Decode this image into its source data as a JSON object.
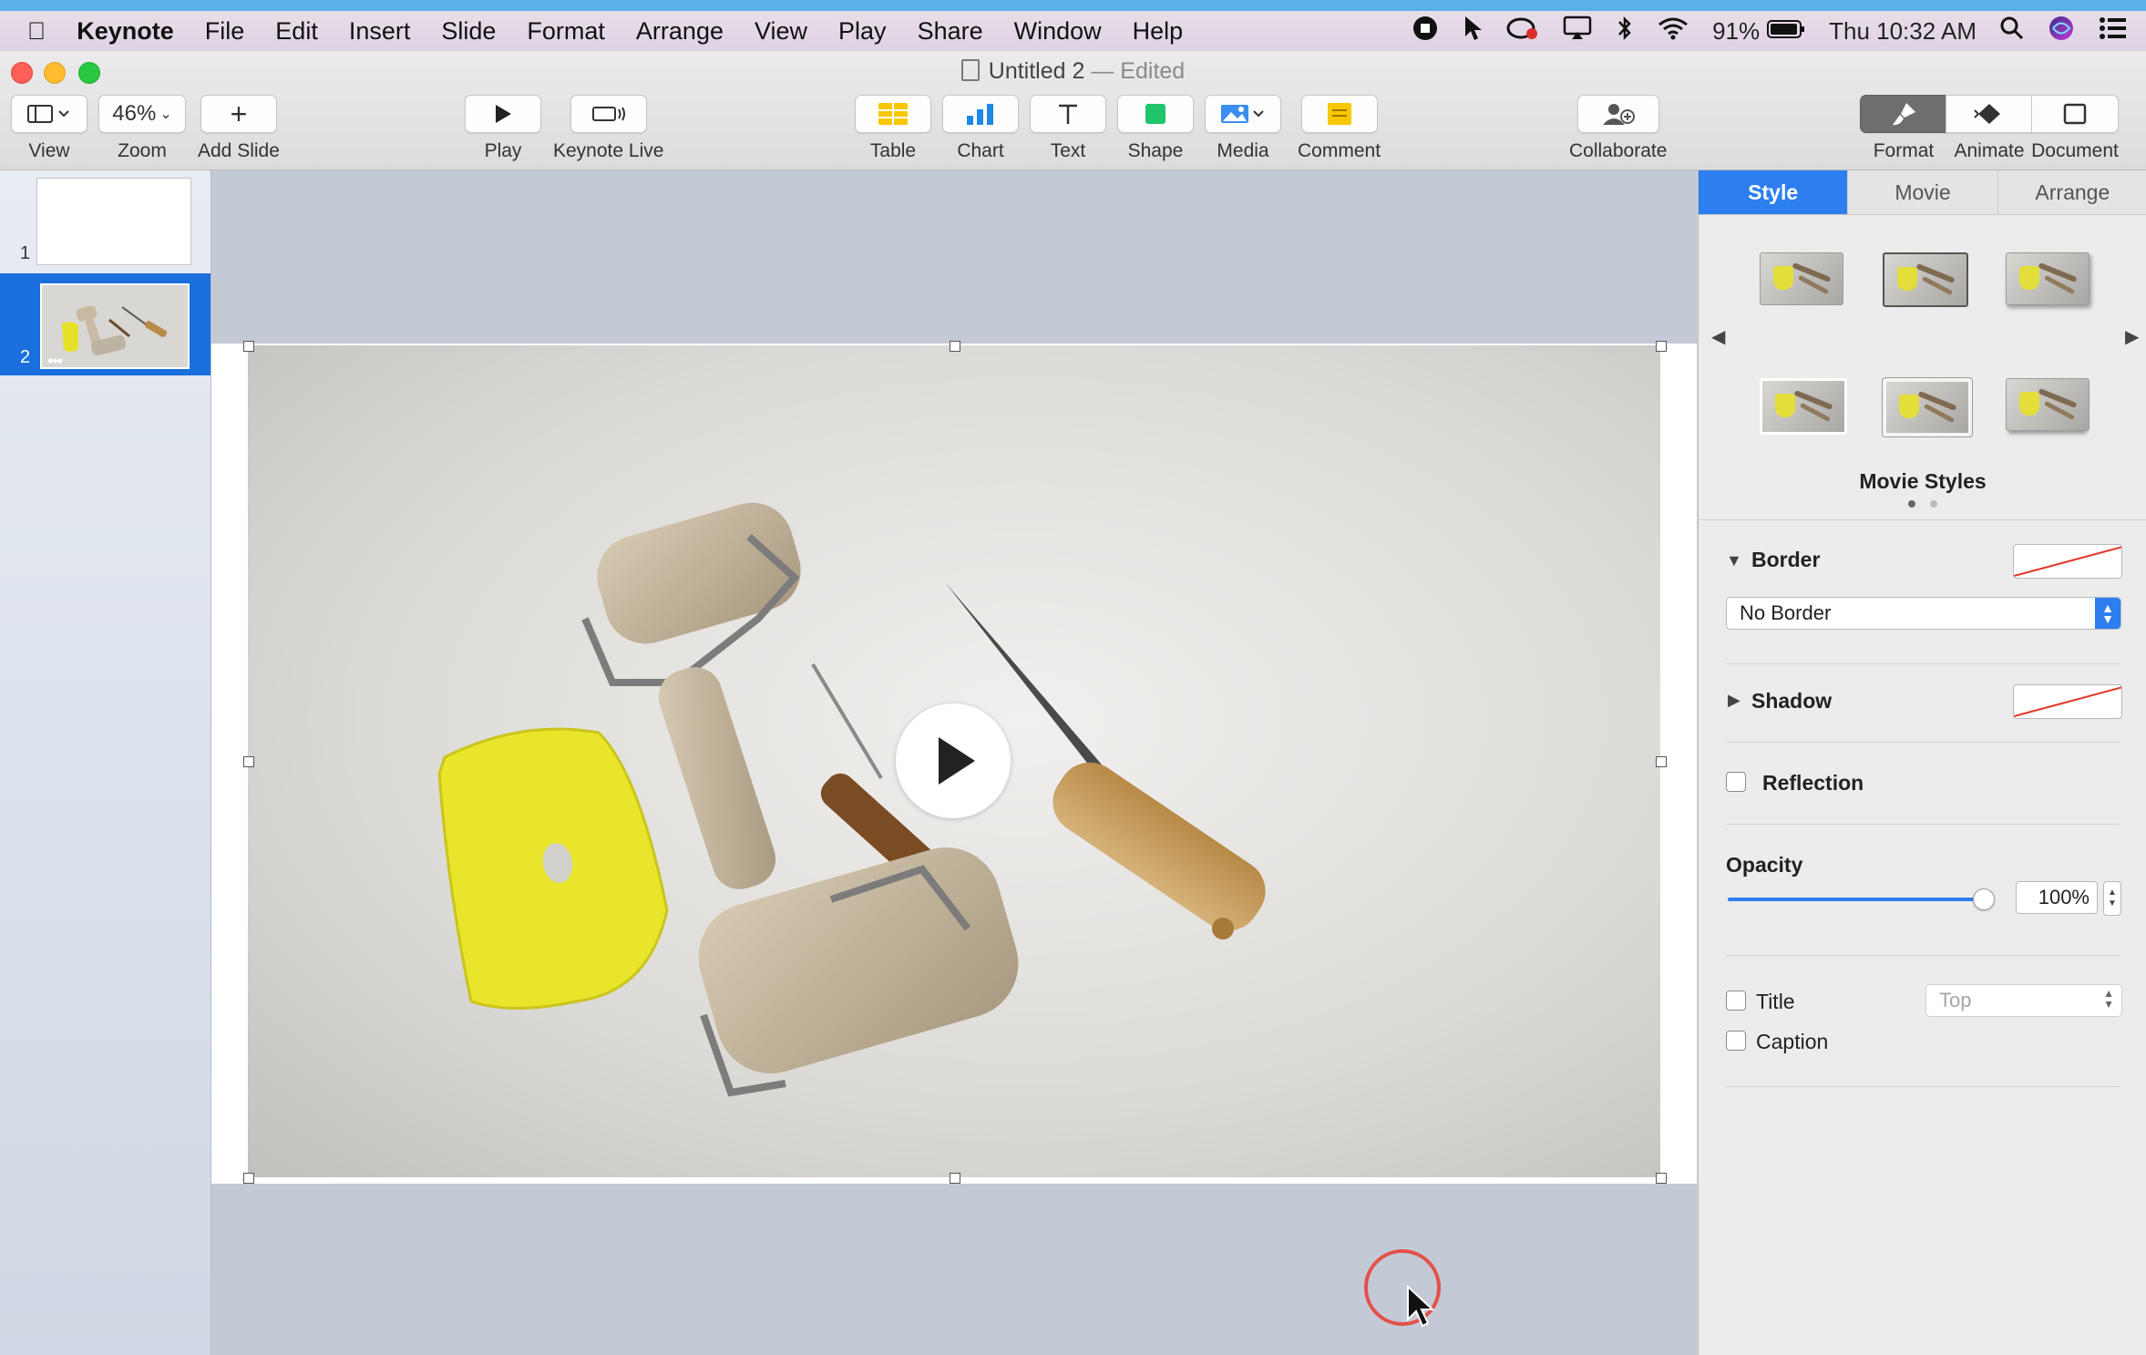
{
  "menubar": {
    "app_name": "Keynote",
    "items": [
      "File",
      "Edit",
      "Insert",
      "Slide",
      "Format",
      "Arrange",
      "View",
      "Play",
      "Share",
      "Window",
      "Help"
    ],
    "battery": "91%",
    "clock": "Thu 10:32 AM"
  },
  "window": {
    "title": "Untitled 2",
    "edited": "— Edited"
  },
  "toolbar": {
    "view": "View",
    "zoom_value": "46%",
    "zoom": "Zoom",
    "add_slide": "Add Slide",
    "play": "Play",
    "keynote_live": "Keynote Live",
    "table": "Table",
    "chart": "Chart",
    "text": "Text",
    "shape": "Shape",
    "media": "Media",
    "comment": "Comment",
    "collaborate": "Collaborate",
    "format": "Format",
    "animate": "Animate",
    "document": "Document"
  },
  "navigator": {
    "slides": [
      {
        "number": "1"
      },
      {
        "number": "2"
      }
    ]
  },
  "inspector": {
    "tabs": [
      "Style",
      "Movie",
      "Arrange"
    ],
    "movie_styles_label": "Movie Styles",
    "border_label": "Border",
    "border_value": "No Border",
    "shadow_label": "Shadow",
    "reflection_label": "Reflection",
    "opacity_label": "Opacity",
    "opacity_value": "100%",
    "opacity_level": 1.0,
    "title_label": "Title",
    "title_position": "Top",
    "caption_label": "Caption"
  },
  "colors": {
    "accent": "#2d7ff0",
    "selection": "#1a6fdc",
    "cursor_ring": "#e3514a"
  }
}
